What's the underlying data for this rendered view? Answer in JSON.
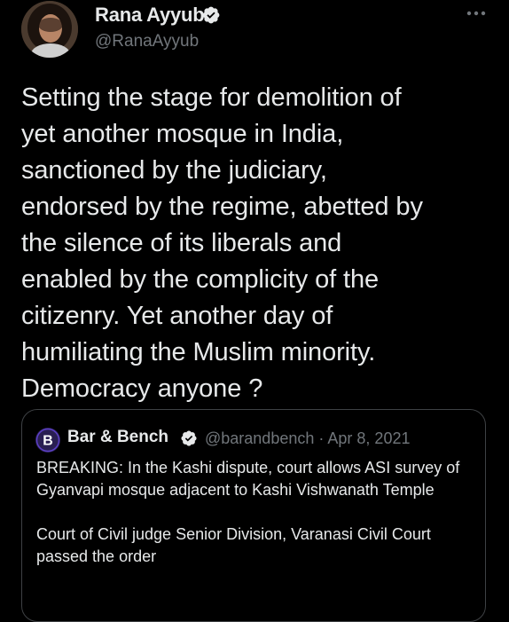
{
  "author": {
    "name": "Rana Ayyub",
    "handle": "@RanaAyyub"
  },
  "tweet": {
    "text": "Setting the stage for demolition of\nyet another mosque in India,\nsanctioned by the judiciary,\nendorsed by the regime, abetted by\nthe silence of its liberals and\nenabled by the complicity of the\ncitizenry. Yet another day of\nhumiliating the Muslim minority.\nDemocracy anyone ?"
  },
  "quoted_tweet": {
    "name": "Bar & Bench",
    "handle": "@barandbench",
    "separator": "·",
    "date": "Apr 8, 2021",
    "avatar_letter": "B",
    "paragraphs": [
      "BREAKING: In the Kashi dispute, court allows ASI survey of Gyanvapi mosque adjacent to Kashi Vishwanath Temple",
      "Court of Civil judge Senior Division, Varanasi Civil Court passed the order"
    ]
  },
  "icons": {
    "verified": "verified-badge-icon",
    "more": "more-options-icon"
  },
  "colors": {
    "background": "#000000",
    "text": "#e7e9ea",
    "secondary": "#71767b",
    "border": "#3e4144",
    "verified_badge": "#e7e9ea",
    "barandbench_logo": "#5b3fc4"
  }
}
